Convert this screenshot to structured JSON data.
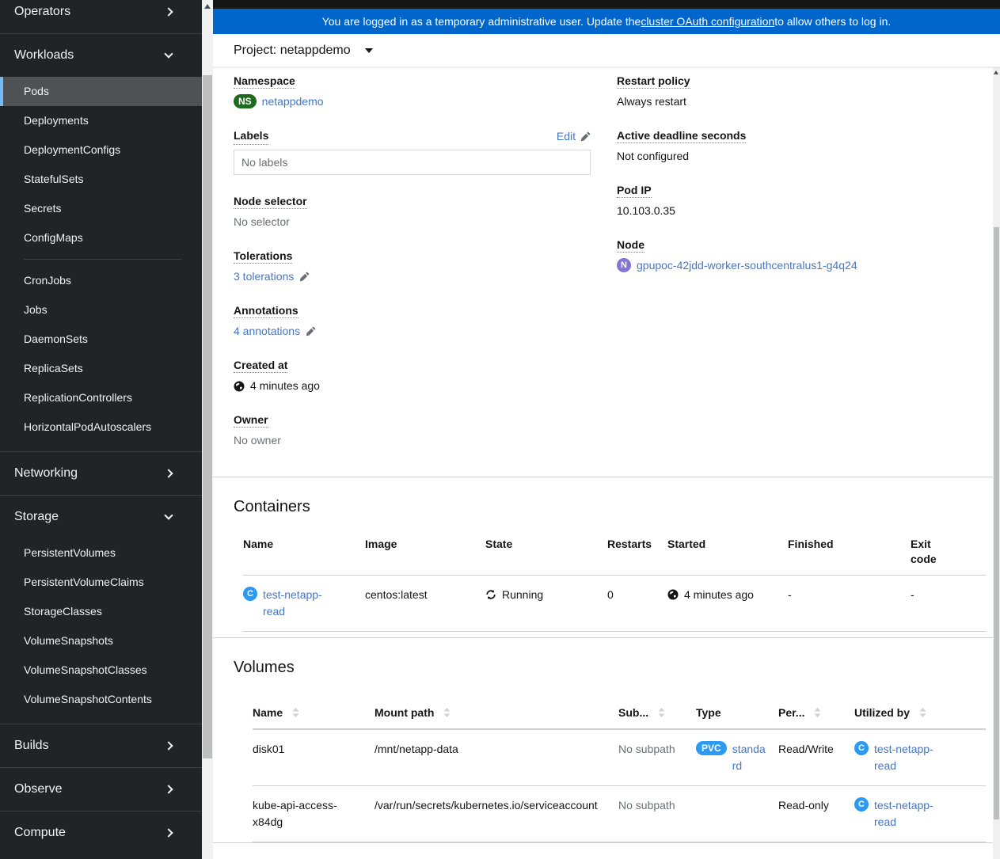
{
  "colors": {
    "banner_bg": "#0066cc",
    "link": "#4576c4",
    "sidebar_bg": "#212427",
    "sidebar_selected_bg": "#4f5255",
    "sidebar_accent": "#73bcf7",
    "namespace_badge": "#1e6b1e",
    "node_badge": "#8476d1",
    "container_badge": "#2b9af3",
    "pvc_badge": "#2b9af3",
    "muted_text": "#6a6e73"
  },
  "banner": {
    "text_before": "You are logged in as a temporary administrative user. Update the ",
    "link": "cluster OAuth configuration",
    "text_after": " to allow others to log in."
  },
  "project_bar": {
    "label": "Project: netappdemo"
  },
  "sidebar": {
    "sections": [
      {
        "label": "Operators",
        "expanded": false
      },
      {
        "label": "Workloads",
        "expanded": true,
        "items": [
          {
            "label": "Pods",
            "active": true
          },
          {
            "label": "Deployments"
          },
          {
            "label": "DeploymentConfigs"
          },
          {
            "label": "StatefulSets"
          },
          {
            "label": "Secrets"
          },
          {
            "label": "ConfigMaps"
          },
          {
            "label": "CronJobs",
            "divider_before": true
          },
          {
            "label": "Jobs"
          },
          {
            "label": "DaemonSets"
          },
          {
            "label": "ReplicaSets"
          },
          {
            "label": "ReplicationControllers"
          },
          {
            "label": "HorizontalPodAutoscalers"
          }
        ]
      },
      {
        "label": "Networking",
        "expanded": false
      },
      {
        "label": "Storage",
        "expanded": true,
        "items": [
          {
            "label": "PersistentVolumes"
          },
          {
            "label": "PersistentVolumeClaims"
          },
          {
            "label": "StorageClasses"
          },
          {
            "label": "VolumeSnapshots"
          },
          {
            "label": "VolumeSnapshotClasses"
          },
          {
            "label": "VolumeSnapshotContents"
          }
        ]
      },
      {
        "label": "Builds",
        "expanded": false
      },
      {
        "label": "Observe",
        "expanded": false
      },
      {
        "label": "Compute",
        "expanded": false
      }
    ]
  },
  "details": {
    "namespace": {
      "label": "Namespace",
      "badge": "NS",
      "value": "netappdemo"
    },
    "labels": {
      "label": "Labels",
      "edit": "Edit",
      "empty": "No labels"
    },
    "node_selector": {
      "label": "Node selector",
      "value": "No selector"
    },
    "tolerations": {
      "label": "Tolerations",
      "link": "3 tolerations"
    },
    "annotations": {
      "label": "Annotations",
      "link": "4 annotations"
    },
    "created_at": {
      "label": "Created at",
      "icon": "globe-icon",
      "value": "4 minutes ago"
    },
    "owner": {
      "label": "Owner",
      "value": "No owner"
    },
    "restart_policy": {
      "label": "Restart policy",
      "value": "Always restart"
    },
    "active_deadline": {
      "label": "Active deadline seconds",
      "value": "Not configured"
    },
    "pod_ip": {
      "label": "Pod IP",
      "value": "10.103.0.35"
    },
    "node": {
      "label": "Node",
      "badge": "N",
      "value": "gpupoc-42jdd-worker-southcentralus1-g4q24"
    }
  },
  "containers": {
    "title": "Containers",
    "columns": [
      {
        "label": "Name"
      },
      {
        "label": "Image"
      },
      {
        "label": "State"
      },
      {
        "label": "Restarts"
      },
      {
        "label": "Started"
      },
      {
        "label": "Finished"
      },
      {
        "label": "Exit code",
        "narrow": true
      }
    ],
    "rows": [
      [
        {
          "kind": "resource-link",
          "badge": "C",
          "icon": "container-badge-icon",
          "text": "test-netapp-read"
        },
        {
          "kind": "text",
          "text": "centos:latest"
        },
        {
          "kind": "state",
          "icon": "sync-icon",
          "text": "Running"
        },
        {
          "kind": "text",
          "text": "0"
        },
        {
          "kind": "time",
          "icon": "globe-icon",
          "text": "4 minutes ago"
        },
        {
          "kind": "text",
          "text": "-"
        },
        {
          "kind": "text",
          "text": "-"
        }
      ]
    ]
  },
  "volumes": {
    "title": "Volumes",
    "columns": [
      {
        "label": "Name",
        "sortable": true
      },
      {
        "label": "Mount path",
        "sortable": true
      },
      {
        "label": "Sub...",
        "sortable": true
      },
      {
        "label": "Type"
      },
      {
        "label": "Per...",
        "sortable": true
      },
      {
        "label": "Utilized by",
        "sortable": true
      }
    ],
    "rows": [
      [
        {
          "kind": "text",
          "text": "disk01"
        },
        {
          "kind": "text",
          "text": "/mnt/netapp-data"
        },
        {
          "kind": "muted",
          "text": "No subpath"
        },
        {
          "kind": "pvc-link",
          "badge": "PVC",
          "icon": "pvc-badge-icon",
          "text": "standard"
        },
        {
          "kind": "text",
          "text": "Read/Write"
        },
        {
          "kind": "resource-link",
          "badge": "C",
          "icon": "container-badge-icon",
          "text": "test-netapp-read"
        }
      ],
      [
        {
          "kind": "text",
          "text": "kube-api-access-x84dg"
        },
        {
          "kind": "text",
          "text": "/var/run/secrets/kubernetes.io/serviceaccount"
        },
        {
          "kind": "muted",
          "text": "No subpath"
        },
        {
          "kind": "empty"
        },
        {
          "kind": "text",
          "text": "Read-only"
        },
        {
          "kind": "resource-link",
          "badge": "C",
          "icon": "container-badge-icon",
          "text": "test-netapp-read"
        }
      ]
    ]
  }
}
